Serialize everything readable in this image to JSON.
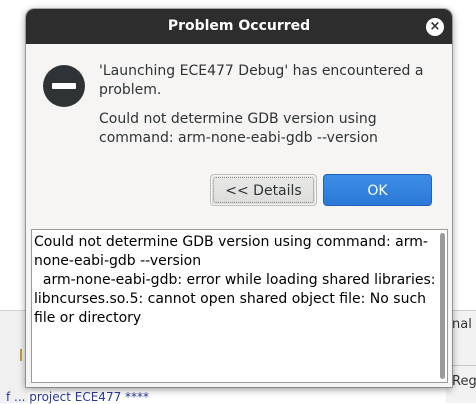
{
  "background": {
    "right_tab_top": "nal",
    "right_tab_bottom": "Reg",
    "bottom_text": "f ... project ECE477 ****"
  },
  "dialog": {
    "title": "Problem Occurred",
    "close_label": "×",
    "message_title": "'Launching ECE477 Debug' has encountered a problem.",
    "message_body": "Could not determine GDB version using command: arm-none-eabi-gdb --version",
    "details_button": "<< Details",
    "ok_button": "OK",
    "details_text": "Could not determine GDB version using command: arm-none-eabi-gdb --version\n  arm-none-eabi-gdb: error while loading shared libraries: libncurses.so.5: cannot open shared object file: No such file or directory"
  },
  "icons": {
    "error": "error-icon",
    "close": "close-icon"
  },
  "colors": {
    "titlebar": "#2d2d2d",
    "ok_button": "#3584e4",
    "dialog_background": "#f6f5f4"
  }
}
